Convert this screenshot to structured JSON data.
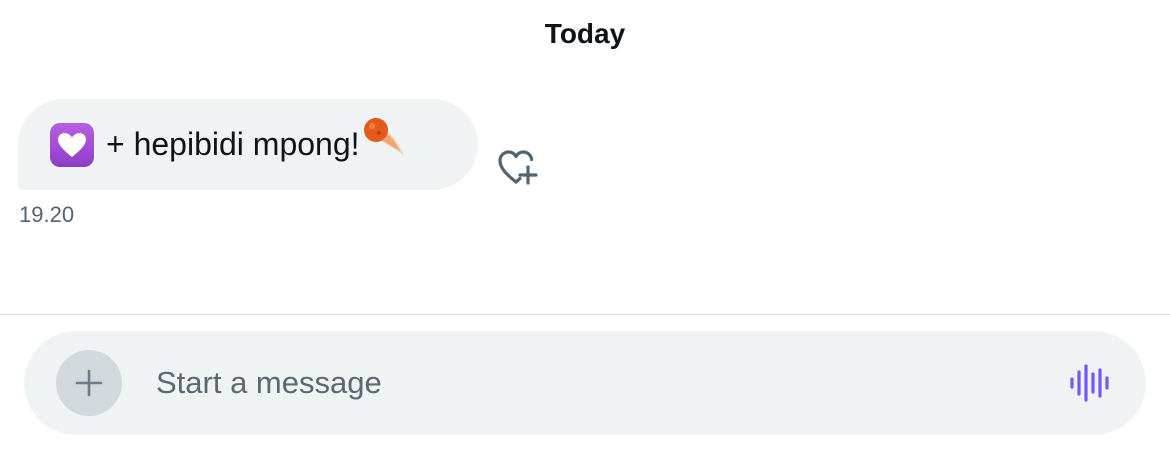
{
  "conversation": {
    "date_label": "Today",
    "messages": [
      {
        "emoji_start": "heart-decoration-icon",
        "text": "+ hepibidi mpong!",
        "emoji_end": "comet-icon",
        "time": "19.20"
      }
    ],
    "react_icon": "heart-plus-icon"
  },
  "composer": {
    "placeholder": "Start a message",
    "value": "",
    "add_icon": "plus-icon",
    "voice_icon": "voice-waveform-icon"
  },
  "colors": {
    "bubble": "#eff3f4",
    "text": "#0f1419",
    "muted": "#536471",
    "voice_accent": "#7856ff",
    "divider": "#cfd9de"
  }
}
